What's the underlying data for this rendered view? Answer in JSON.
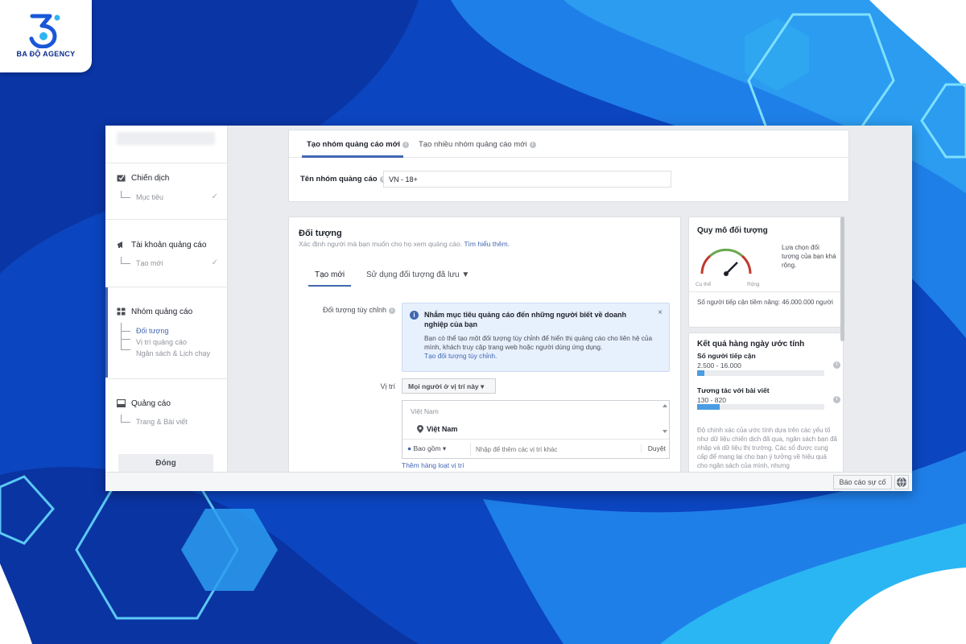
{
  "branding": {
    "logo_text": "BA ĐỘ AGENCY"
  },
  "colors": {
    "accent": "#4267b2",
    "background": "#0a3fb8",
    "bar_fill": "#4b9ce2"
  },
  "sidebar": {
    "sections": [
      {
        "title": "Chiến dịch",
        "icon": "campaign-icon",
        "items": [
          {
            "label": "Mục tiêu",
            "done": true
          }
        ]
      },
      {
        "title": "Tài khoản quảng cáo",
        "icon": "megaphone-icon",
        "items": [
          {
            "label": "Tạo mới",
            "done": true
          }
        ]
      },
      {
        "title": "Nhóm quảng cáo",
        "icon": "grid-icon",
        "items": [
          {
            "label": "Đối tượng",
            "active": true
          },
          {
            "label": "Vị trí quảng cáo"
          },
          {
            "label": "Ngân sách & Lịch chạy"
          }
        ]
      },
      {
        "title": "Quảng cáo",
        "icon": "ad-icon",
        "items": [
          {
            "label": "Trang & Bài viết"
          }
        ]
      }
    ],
    "close_label": "Đóng"
  },
  "top": {
    "tabs": [
      {
        "label": "Tạo nhóm quảng cáo mới"
      },
      {
        "label": "Tạo nhiều nhóm quảng cáo mới"
      }
    ],
    "name_label": "Tên nhóm quảng cáo",
    "name_value": "VN - 18+"
  },
  "audience": {
    "title": "Đối tượng",
    "desc": "Xác định người mà bạn muốn cho họ xem quảng cáo.",
    "learn_more": "Tìm hiểu thêm.",
    "tabs": [
      "Tạo mới",
      "Sử dụng đối tượng đã lưu ▼"
    ],
    "custom_label": "Đối tượng tùy chỉnh",
    "notice": {
      "title": "Nhắm mục tiêu quảng cáo đến những người biết về doanh nghiệp của bạn",
      "body": "Bạn có thể tạo một đối tượng tùy chỉnh để hiển thị quảng cáo cho liên hệ của mình, khách truy cập trang web hoặc người dùng ứng dụng.",
      "link": "Tạo đối tượng tùy chỉnh."
    },
    "location_label": "Vị trí",
    "location_select": "Mọi người ở vị trí này",
    "location_country": "Việt Nam",
    "location_item": "Việt Nam",
    "include_label": "Bao gồm",
    "location_placeholder": "Nhập để thêm các vị trí khác",
    "browse_label": "Duyệt",
    "bulk_link": "Thêm hàng loạt vị trí"
  },
  "audience_size": {
    "title": "Quy mô đối tượng",
    "gauge_left": "Cụ thể",
    "gauge_right": "Rộng",
    "desc": "Lựa chọn đối tượng của bạn khá rộng.",
    "reach": "Số người tiếp cận tiềm năng: 46.000.000 người"
  },
  "daily_results": {
    "title": "Kết quả hàng ngày ước tính",
    "metrics": [
      {
        "label": "Số người tiếp cận",
        "value": "2.500 - 16.000",
        "fill": 0.06
      },
      {
        "label": "Tương tác với bài viết",
        "value": "130 - 820",
        "fill": 0.18
      }
    ],
    "desc": "Độ chính xác của ước tính dựa trên các yếu tố như dữ liệu chiến dịch đã qua, ngân sách bạn đã nhập và dữ liệu thị trường. Các số được cung cấp để mang lại cho bạn ý tưởng về hiệu quả cho ngân sách của mình, nhưng"
  },
  "footer": {
    "report_label": "Báo cáo sự cố"
  }
}
